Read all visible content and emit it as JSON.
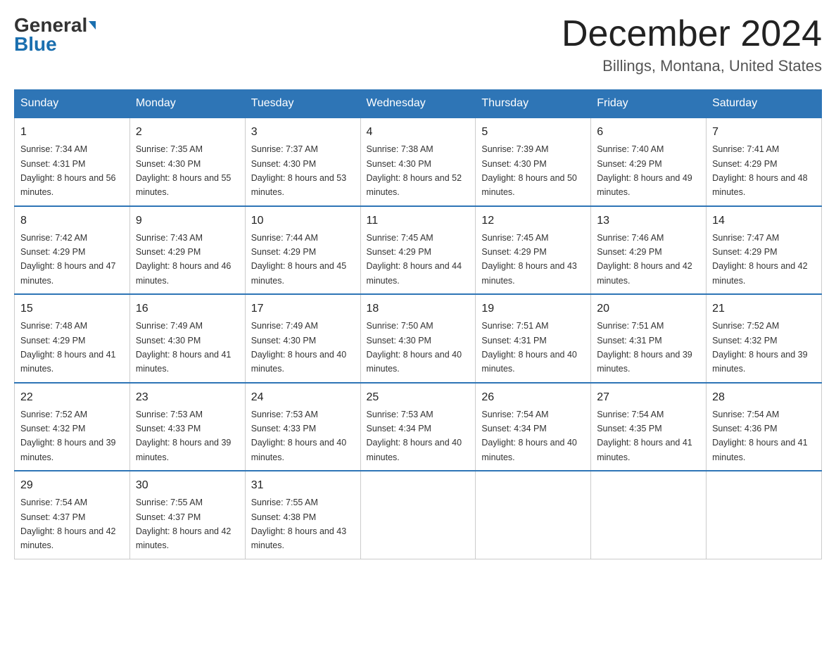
{
  "header": {
    "logo_general": "General",
    "logo_blue": "Blue",
    "month_title": "December 2024",
    "location": "Billings, Montana, United States"
  },
  "days_of_week": [
    "Sunday",
    "Monday",
    "Tuesday",
    "Wednesday",
    "Thursday",
    "Friday",
    "Saturday"
  ],
  "weeks": [
    [
      {
        "day": "1",
        "sunrise": "7:34 AM",
        "sunset": "4:31 PM",
        "daylight": "8 hours and 56 minutes."
      },
      {
        "day": "2",
        "sunrise": "7:35 AM",
        "sunset": "4:30 PM",
        "daylight": "8 hours and 55 minutes."
      },
      {
        "day": "3",
        "sunrise": "7:37 AM",
        "sunset": "4:30 PM",
        "daylight": "8 hours and 53 minutes."
      },
      {
        "day": "4",
        "sunrise": "7:38 AM",
        "sunset": "4:30 PM",
        "daylight": "8 hours and 52 minutes."
      },
      {
        "day": "5",
        "sunrise": "7:39 AM",
        "sunset": "4:30 PM",
        "daylight": "8 hours and 50 minutes."
      },
      {
        "day": "6",
        "sunrise": "7:40 AM",
        "sunset": "4:29 PM",
        "daylight": "8 hours and 49 minutes."
      },
      {
        "day": "7",
        "sunrise": "7:41 AM",
        "sunset": "4:29 PM",
        "daylight": "8 hours and 48 minutes."
      }
    ],
    [
      {
        "day": "8",
        "sunrise": "7:42 AM",
        "sunset": "4:29 PM",
        "daylight": "8 hours and 47 minutes."
      },
      {
        "day": "9",
        "sunrise": "7:43 AM",
        "sunset": "4:29 PM",
        "daylight": "8 hours and 46 minutes."
      },
      {
        "day": "10",
        "sunrise": "7:44 AM",
        "sunset": "4:29 PM",
        "daylight": "8 hours and 45 minutes."
      },
      {
        "day": "11",
        "sunrise": "7:45 AM",
        "sunset": "4:29 PM",
        "daylight": "8 hours and 44 minutes."
      },
      {
        "day": "12",
        "sunrise": "7:45 AM",
        "sunset": "4:29 PM",
        "daylight": "8 hours and 43 minutes."
      },
      {
        "day": "13",
        "sunrise": "7:46 AM",
        "sunset": "4:29 PM",
        "daylight": "8 hours and 42 minutes."
      },
      {
        "day": "14",
        "sunrise": "7:47 AM",
        "sunset": "4:29 PM",
        "daylight": "8 hours and 42 minutes."
      }
    ],
    [
      {
        "day": "15",
        "sunrise": "7:48 AM",
        "sunset": "4:29 PM",
        "daylight": "8 hours and 41 minutes."
      },
      {
        "day": "16",
        "sunrise": "7:49 AM",
        "sunset": "4:30 PM",
        "daylight": "8 hours and 41 minutes."
      },
      {
        "day": "17",
        "sunrise": "7:49 AM",
        "sunset": "4:30 PM",
        "daylight": "8 hours and 40 minutes."
      },
      {
        "day": "18",
        "sunrise": "7:50 AM",
        "sunset": "4:30 PM",
        "daylight": "8 hours and 40 minutes."
      },
      {
        "day": "19",
        "sunrise": "7:51 AM",
        "sunset": "4:31 PM",
        "daylight": "8 hours and 40 minutes."
      },
      {
        "day": "20",
        "sunrise": "7:51 AM",
        "sunset": "4:31 PM",
        "daylight": "8 hours and 39 minutes."
      },
      {
        "day": "21",
        "sunrise": "7:52 AM",
        "sunset": "4:32 PM",
        "daylight": "8 hours and 39 minutes."
      }
    ],
    [
      {
        "day": "22",
        "sunrise": "7:52 AM",
        "sunset": "4:32 PM",
        "daylight": "8 hours and 39 minutes."
      },
      {
        "day": "23",
        "sunrise": "7:53 AM",
        "sunset": "4:33 PM",
        "daylight": "8 hours and 39 minutes."
      },
      {
        "day": "24",
        "sunrise": "7:53 AM",
        "sunset": "4:33 PM",
        "daylight": "8 hours and 40 minutes."
      },
      {
        "day": "25",
        "sunrise": "7:53 AM",
        "sunset": "4:34 PM",
        "daylight": "8 hours and 40 minutes."
      },
      {
        "day": "26",
        "sunrise": "7:54 AM",
        "sunset": "4:34 PM",
        "daylight": "8 hours and 40 minutes."
      },
      {
        "day": "27",
        "sunrise": "7:54 AM",
        "sunset": "4:35 PM",
        "daylight": "8 hours and 41 minutes."
      },
      {
        "day": "28",
        "sunrise": "7:54 AM",
        "sunset": "4:36 PM",
        "daylight": "8 hours and 41 minutes."
      }
    ],
    [
      {
        "day": "29",
        "sunrise": "7:54 AM",
        "sunset": "4:37 PM",
        "daylight": "8 hours and 42 minutes."
      },
      {
        "day": "30",
        "sunrise": "7:55 AM",
        "sunset": "4:37 PM",
        "daylight": "8 hours and 42 minutes."
      },
      {
        "day": "31",
        "sunrise": "7:55 AM",
        "sunset": "4:38 PM",
        "daylight": "8 hours and 43 minutes."
      },
      null,
      null,
      null,
      null
    ]
  ],
  "labels": {
    "sunrise_prefix": "Sunrise: ",
    "sunset_prefix": "Sunset: ",
    "daylight_prefix": "Daylight: "
  }
}
